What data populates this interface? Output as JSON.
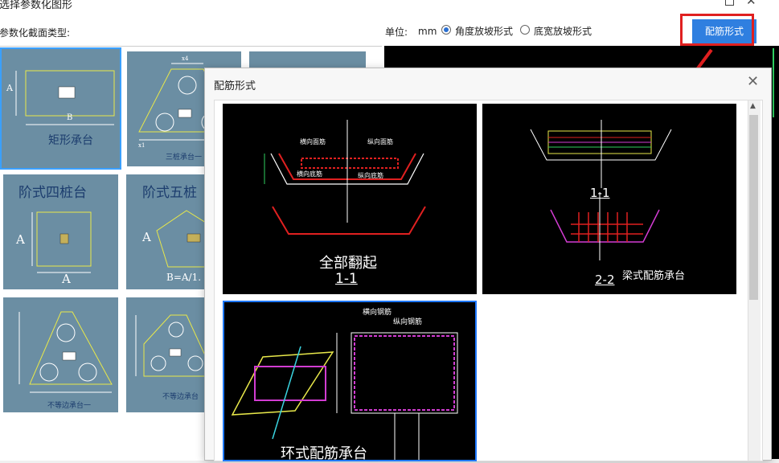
{
  "window": {
    "title": "选择参数化图形",
    "type_label": "参数化截面类型:",
    "unit_label": "单位:",
    "unit_value": "mm",
    "radio1_label": "角度放坡形式",
    "radio2_label": "底宽放坡形式",
    "button_label": "配筋形式"
  },
  "shapes": {
    "cell1": {
      "title": "矩形承台",
      "dim_a": "A",
      "dim_b": "B"
    },
    "cell2": {
      "title": "三桩承台一",
      "dim1": "x4",
      "dim2": "x1"
    },
    "cell4": {
      "title": "阶式四桩台",
      "dim_a": "A",
      "dim_b": "A"
    },
    "cell5": {
      "title": "阶式五桩",
      "dim_a": "A",
      "formula": "B=A/1."
    },
    "cell7": {
      "title": "不等边承台一"
    },
    "cell8": {
      "title": "不等边承台"
    }
  },
  "dialog": {
    "title": "配筋形式",
    "thumb1": {
      "caption": "全部翻起",
      "section": "1-1"
    },
    "thumb2": {
      "section_a": "1-1",
      "section_b": "2-2",
      "caption": "梁式配筋承台"
    },
    "thumb3": {
      "caption": "环式配筋承台"
    }
  },
  "colors": {
    "accent": "#2f7fe0",
    "highlight": "#e02020",
    "cell_bg": "#6b8ea3"
  }
}
